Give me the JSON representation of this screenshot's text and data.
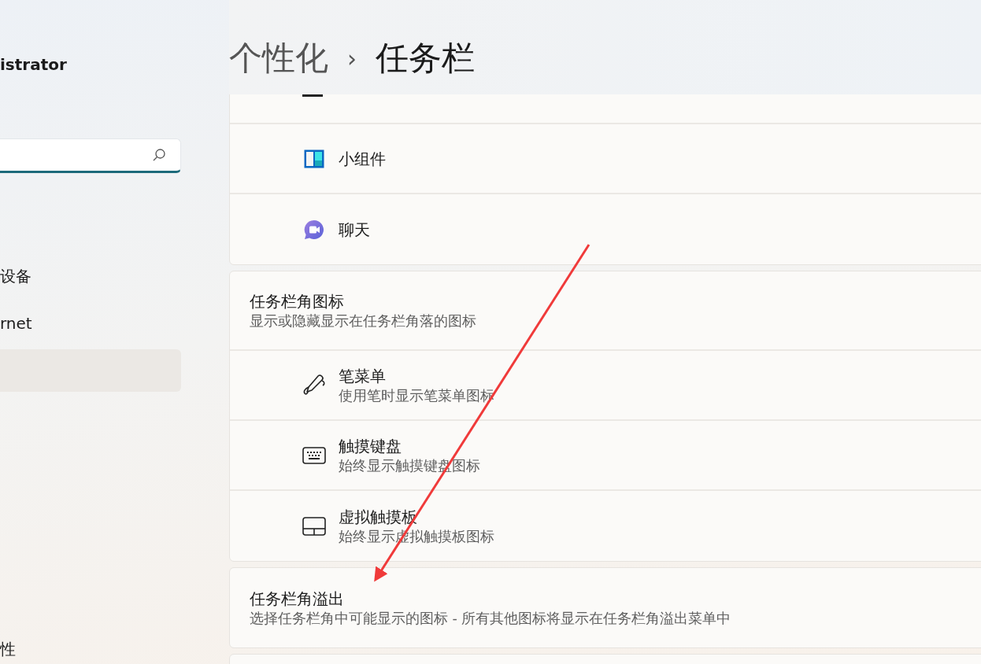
{
  "sidebar": {
    "user_name": "istrator",
    "search": {
      "kind": "field"
    },
    "items": [
      {
        "label": "设备",
        "selected": false
      },
      {
        "label": "rnet",
        "selected": false
      },
      {
        "selected": true
      }
    ],
    "bottom_item": {
      "label": "性",
      "selected": false
    }
  },
  "breadcrumb": {
    "parent": "个性化",
    "separator": "›",
    "current": "任务栏"
  },
  "groups": [
    {
      "rows": [
        {
          "kind": "cut"
        },
        {
          "kind": "item",
          "title": "小组件"
        },
        {
          "kind": "item",
          "title": "聊天"
        }
      ]
    },
    {
      "title": "任务栏角图标",
      "subtitle": "显示或隐藏显示在任务栏角落的图标",
      "rows": [
        {
          "kind": "item",
          "title": "笔菜单",
          "subtitle": "使用笔时显示笔菜单图标"
        },
        {
          "kind": "item",
          "title": "触摸键盘",
          "subtitle": "始终显示触摸键盘图标"
        },
        {
          "kind": "item",
          "title": "虚拟触摸板",
          "subtitle": "始终显示虚拟触摸板图标"
        }
      ]
    },
    {
      "title": "任务栏角溢出",
      "subtitle": "选择任务栏角中可能显示的图标 - 所有其他图标将显示在任务栏角溢出菜单中"
    },
    {
      "kind": "cut"
    }
  ]
}
